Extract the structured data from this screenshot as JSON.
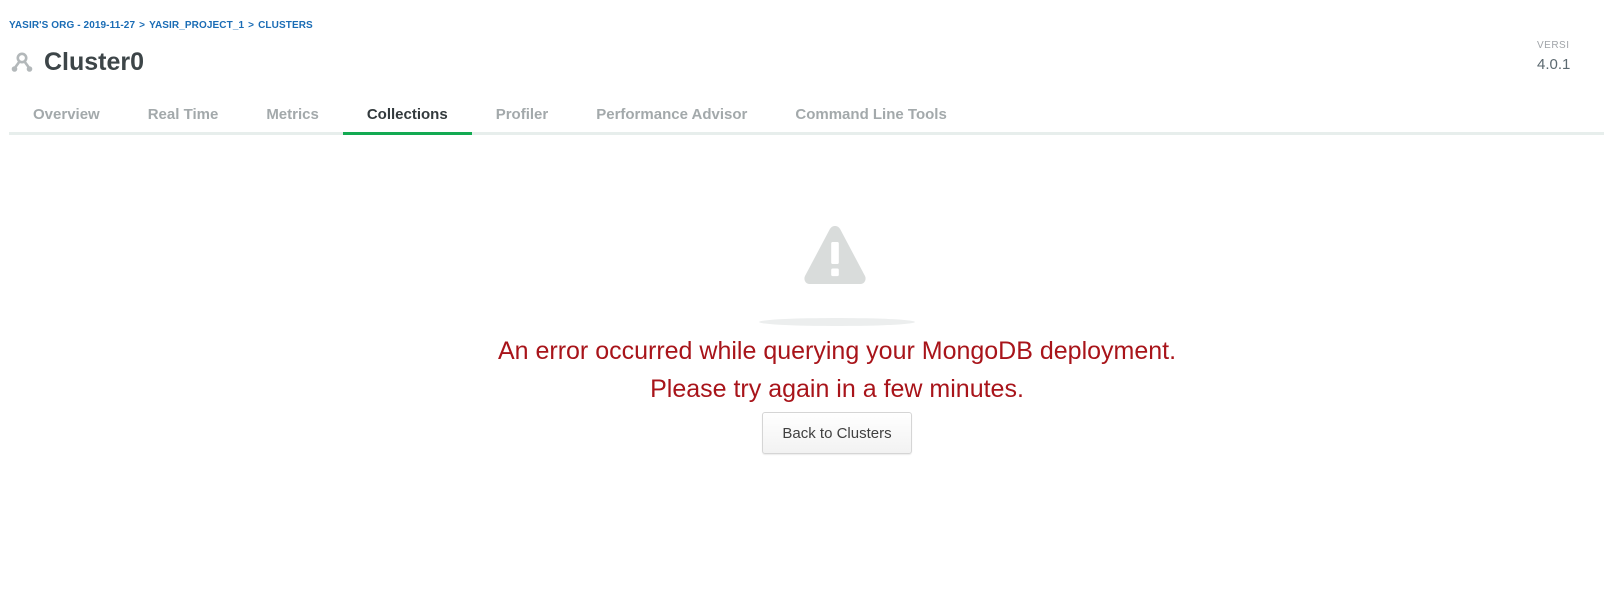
{
  "breadcrumb": {
    "org": "YASIR'S ORG - 2019-11-27",
    "sep1": ">",
    "project": "YASIR_PROJECT_1",
    "sep2": ">",
    "section": "CLUSTERS"
  },
  "cluster": {
    "icon": "cluster-icon",
    "title": "Cluster0"
  },
  "version": {
    "label": "VERSI",
    "value": "4.0.1"
  },
  "tabs": [
    {
      "label": "Overview",
      "active": false
    },
    {
      "label": "Real Time",
      "active": false
    },
    {
      "label": "Metrics",
      "active": false
    },
    {
      "label": "Collections",
      "active": true
    },
    {
      "label": "Profiler",
      "active": false
    },
    {
      "label": "Performance Advisor",
      "active": false
    },
    {
      "label": "Command Line Tools",
      "active": false
    }
  ],
  "error": {
    "icon": "warning-icon",
    "line1": "An error occurred while querying your MongoDB deployment.",
    "line2": "Please try again in a few minutes.",
    "button_label": "Back to Clusters"
  },
  "colors": {
    "breadcrumb": "#1a6cb5",
    "active_tab_underline": "#13aa52",
    "error_text": "#a8141a",
    "warning_icon": "#d9dcdb"
  }
}
